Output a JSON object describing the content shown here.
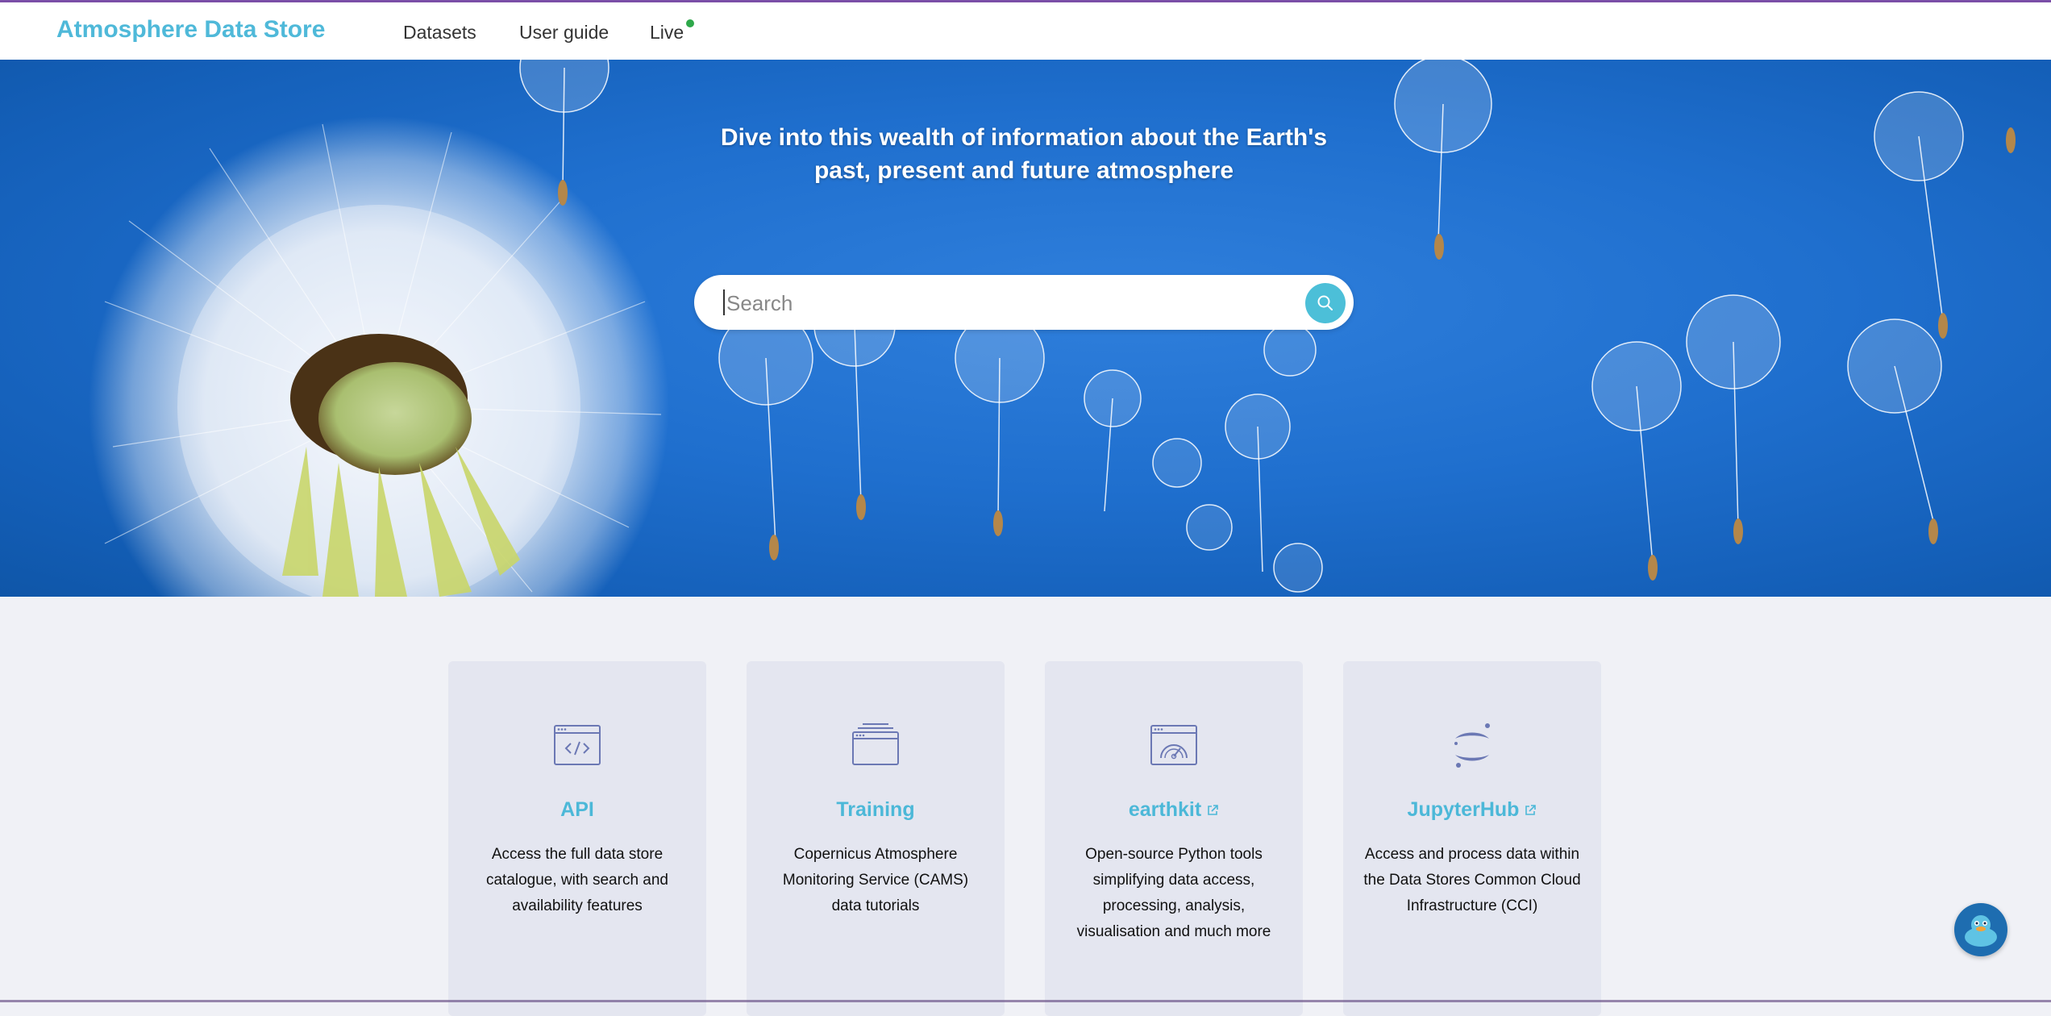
{
  "header": {
    "brand": "Atmosphere Data Store",
    "nav": [
      {
        "label": "Datasets"
      },
      {
        "label": "User guide"
      },
      {
        "label": "Live"
      }
    ]
  },
  "hero": {
    "title_line1": "Dive into this wealth of information about the Earth's",
    "title_line2": "past, present and future atmosphere",
    "search": {
      "placeholder": "Search",
      "value": ""
    }
  },
  "cards": [
    {
      "title": "API",
      "icon": "code-window-icon",
      "external": false,
      "desc": [
        "Access the full data store",
        "catalogue, with search and",
        "availability features"
      ]
    },
    {
      "title": "Training",
      "icon": "stacked-windows-icon",
      "external": false,
      "desc": [
        "Copernicus Atmosphere",
        "Monitoring Service (CAMS)",
        "data tutorials"
      ]
    },
    {
      "title": "earthkit",
      "icon": "gauge-window-icon",
      "external": true,
      "desc": [
        "Open-source Python tools",
        "simplifying data access,",
        "processing, analysis,",
        "visualisation and much more"
      ]
    },
    {
      "title": "JupyterHub",
      "icon": "jupyter-icon",
      "external": true,
      "desc": [
        "Access and process data within",
        "the Data Stores Common Cloud",
        "Infrastructure (CCI)"
      ]
    }
  ],
  "colors": {
    "accent": "#4cb8d8",
    "brand": "#4fb9d9",
    "live_dot": "#2ea84a",
    "hero_blue": "#1f6fce",
    "icon": "#6b78b4"
  }
}
